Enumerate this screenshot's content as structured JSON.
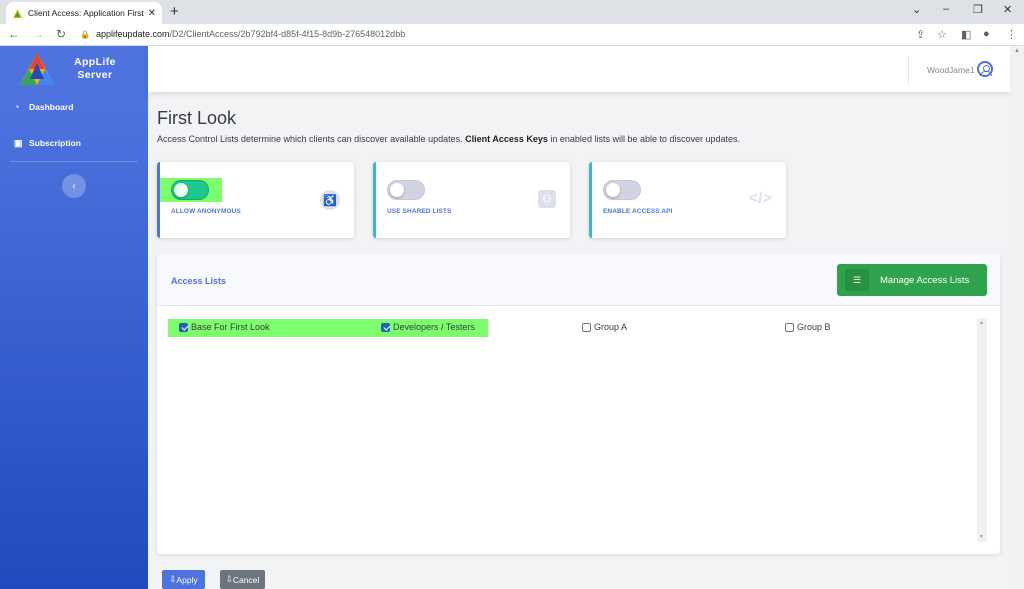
{
  "browser": {
    "tab_title": "Client Access: Application First Lo",
    "tab_close": "✕",
    "new_tab": "+",
    "url_host": "applifeupdate.com",
    "url_path": "/D2/ClientAccess/2b792bf4-d85f-4f15-8d9b-276548012dbb",
    "window_controls": [
      "⌄",
      "–",
      "❐",
      "✕"
    ]
  },
  "sidebar": {
    "brand_line1": "AppLife",
    "brand_line2": "Server",
    "items": [
      {
        "label": "Dashboard",
        "icon": "gauge-icon"
      },
      {
        "label": "Subscription",
        "icon": "subscription-icon"
      }
    ],
    "toggle": "‹"
  },
  "topbar": {
    "user": "WoodJame1"
  },
  "page": {
    "title": "First Look",
    "desc_pre": "Access Control Lists determine which clients can discover available updates.",
    "desc_bold": "Client Access Keys",
    "desc_post": "in enabled lists will be able to discover updates."
  },
  "cards": [
    {
      "label": "ALLOW ANONYMOUS",
      "on": true,
      "icon": "accessibility-icon",
      "accent": "#4e73df"
    },
    {
      "label": "USE SHARED LISTS",
      "on": false,
      "icon": "shared-icon",
      "accent": "#36b9cc"
    },
    {
      "label": "ENABLE ACCESS API",
      "on": false,
      "icon": "code-icon",
      "accent": "#36b9cc",
      "icon_text": "</>"
    }
  ],
  "access_lists": {
    "title": "Access Lists",
    "manage_label": "Manage Access Lists",
    "items": [
      {
        "label": "Base For First Look",
        "checked": true
      },
      {
        "label": "Developers / Testers",
        "checked": true
      },
      {
        "label": "Group A",
        "checked": false
      },
      {
        "label": "Group B",
        "checked": false
      }
    ]
  },
  "buttons": {
    "apply": "Apply",
    "cancel": "Cancel"
  },
  "colors": {
    "primary": "#4e73df",
    "success": "#2fa34b",
    "highlight": "#7dff6b"
  }
}
